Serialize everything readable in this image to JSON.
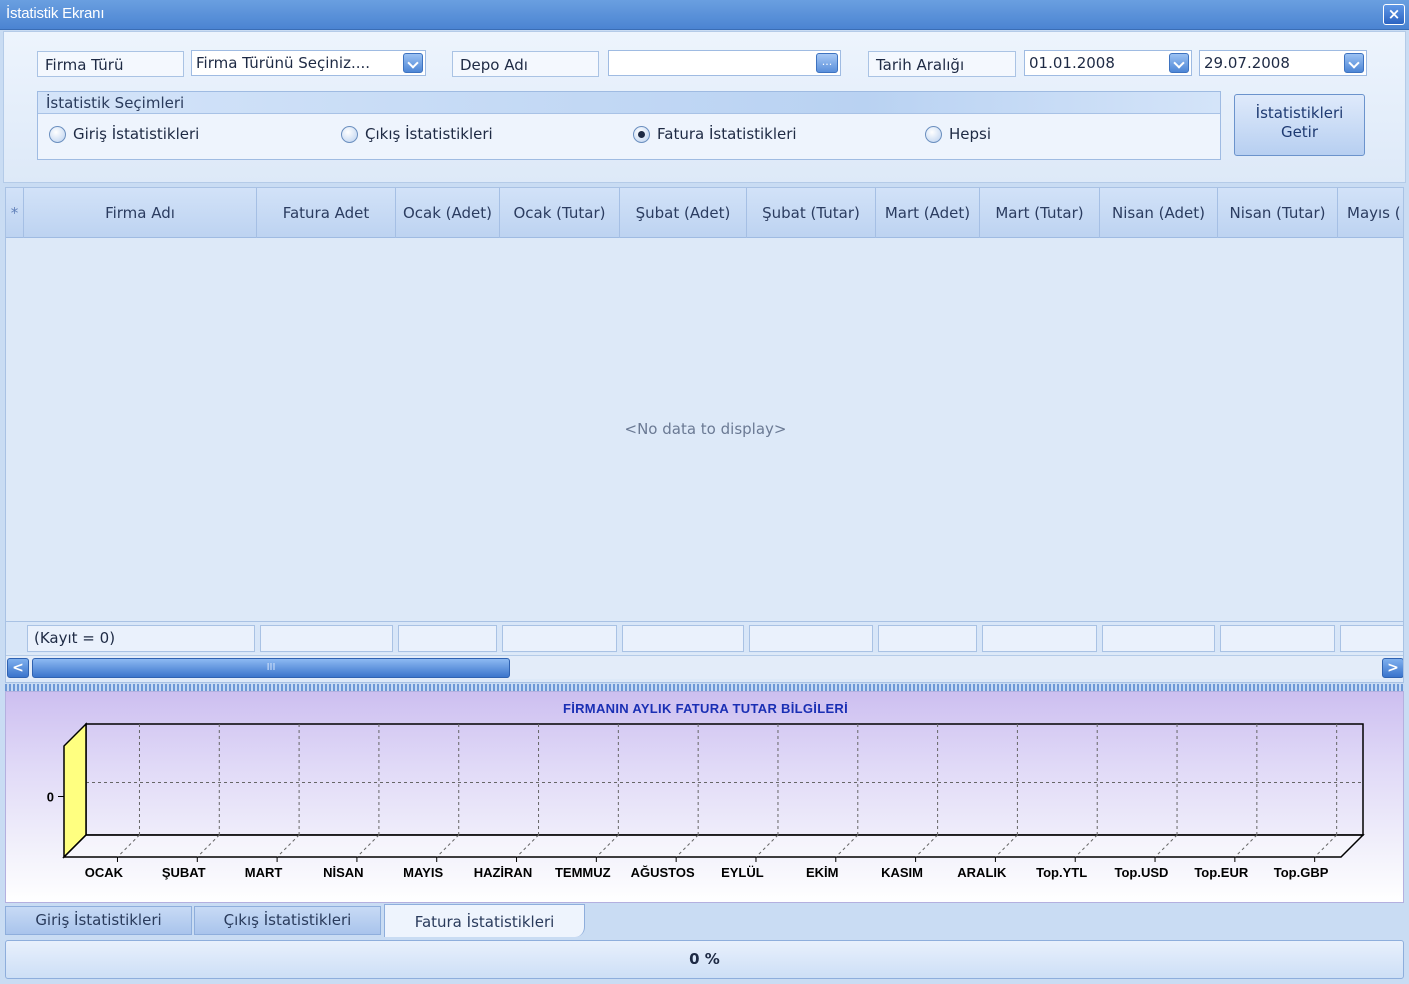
{
  "window": {
    "title": "İstatistik Ekranı",
    "close_glyph": "×"
  },
  "filters": {
    "firma_turu_label": "Firma Türü",
    "firma_turu_value": "Firma Türünü Seçiniz....",
    "depo_label": "Depo Adı",
    "depo_value": "",
    "depo_button_glyph": "...",
    "tarih_label": "Tarih Aralığı",
    "date_from": "01.01.2008",
    "date_to": "29.07.2008"
  },
  "stat_selection": {
    "title": "İstatistik Seçimleri",
    "options": [
      {
        "label": "Giriş İstatistikleri",
        "checked": false
      },
      {
        "label": "Çıkış İstatistikleri",
        "checked": false
      },
      {
        "label": "Fatura İstatistikleri",
        "checked": true
      },
      {
        "label": "Hepsi",
        "checked": false
      }
    ]
  },
  "get_button": {
    "line1": "İstatistikleri",
    "line2": "Getir"
  },
  "grid": {
    "new_row_glyph": "*",
    "columns": [
      "Firma Adı",
      "Fatura Adet",
      "Ocak (Adet)",
      "Ocak (Tutar)",
      "Şubat (Adet)",
      "Şubat (Tutar)",
      "Mart (Adet)",
      "Mart (Tutar)",
      "Nisan (Adet)",
      "Nisan (Tutar)",
      "Mayıs ("
    ],
    "empty_text": "<No data to display>",
    "footer_count": "(Kayıt = 0)",
    "scroll_left_glyph": "<",
    "scroll_right_glyph": ">",
    "scroll_thumb_grip": "III"
  },
  "chart_data": {
    "type": "bar",
    "title": "FİRMANIN AYLIK FATURA TUTAR BİLGİLERİ",
    "categories": [
      "OCAK",
      "ŞUBAT",
      "MART",
      "NİSAN",
      "MAYIS",
      "HAZİRAN",
      "TEMMUZ",
      "AĞUSTOS",
      "EYLÜL",
      "EKİM",
      "KASIM",
      "ARALIK",
      "Top.YTL",
      "Top.USD",
      "Top.EUR",
      "Top.GBP"
    ],
    "values": [
      0,
      0,
      0,
      0,
      0,
      0,
      0,
      0,
      0,
      0,
      0,
      0,
      0,
      0,
      0,
      0
    ],
    "y_ticks": [
      "0"
    ],
    "grid": true,
    "three_d": true,
    "wall_color": "#ffff80"
  },
  "tabs": [
    {
      "label": "Giriş İstatistikleri",
      "active": false
    },
    {
      "label": "Çıkış İstatistikleri",
      "active": false
    },
    {
      "label": "Fatura İstatistikleri",
      "active": true
    }
  ],
  "progress": {
    "text": "0 %",
    "value": 0
  }
}
